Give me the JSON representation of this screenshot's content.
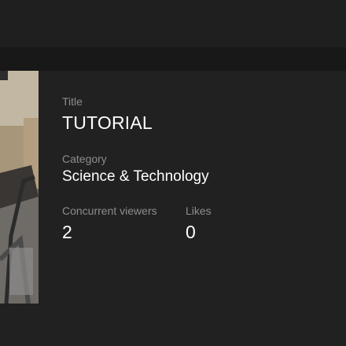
{
  "stream": {
    "title_label": "Title",
    "title": "TUTORIAL",
    "category_label": "Category",
    "category": "Science & Technology",
    "viewers_label": "Concurrent viewers",
    "viewers": "2",
    "likes_label": "Likes",
    "likes": "0"
  },
  "colors": {
    "background": "#212121",
    "band": "#181818",
    "label": "#8d8d8d",
    "value": "#ffffff"
  }
}
